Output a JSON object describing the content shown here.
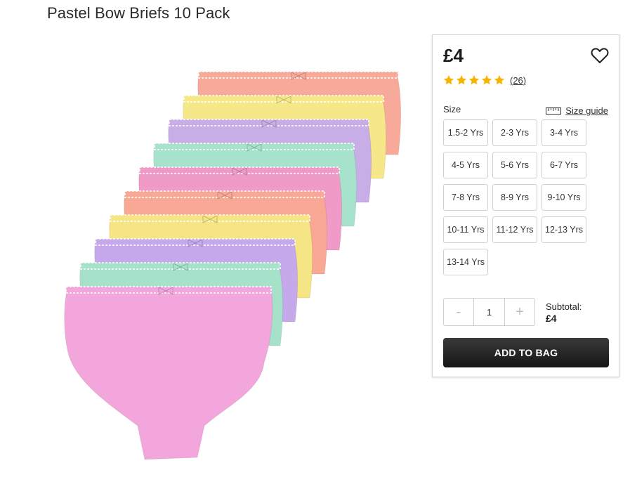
{
  "product": {
    "title": "Pastel Bow Briefs 10 Pack"
  },
  "purchase": {
    "price": "£4",
    "rating": 5,
    "reviews": "(26)",
    "size_label": "Size",
    "size_guide": "Size guide",
    "sizes": [
      "1.5-2 Yrs",
      "2-3 Yrs",
      "3-4 Yrs",
      "4-5 Yrs",
      "5-6 Yrs",
      "6-7 Yrs",
      "7-8 Yrs",
      "8-9 Yrs",
      "9-10 Yrs",
      "10-11 Yrs",
      "11-12 Yrs",
      "12-13 Yrs",
      "13-14 Yrs"
    ],
    "qty_minus": "-",
    "qty_value": "1",
    "qty_plus": "+",
    "subtotal_label": "Subtotal:",
    "subtotal_value": "£4",
    "add_to_bag": "ADD TO BAG"
  },
  "colors": {
    "star": "#f5b400",
    "button": "#222222",
    "border": "#cfcfcf"
  },
  "briefs": [
    {
      "color": "#f7a99a"
    },
    {
      "color": "#f6e889"
    },
    {
      "color": "#c7aee6"
    },
    {
      "color": "#a7e3cc"
    },
    {
      "color": "#f09ac8"
    },
    {
      "color": "#f8a894"
    },
    {
      "color": "#f6e584"
    },
    {
      "color": "#c6a9ea"
    },
    {
      "color": "#a6e2c9"
    },
    {
      "color": "#f3a6dc"
    }
  ]
}
